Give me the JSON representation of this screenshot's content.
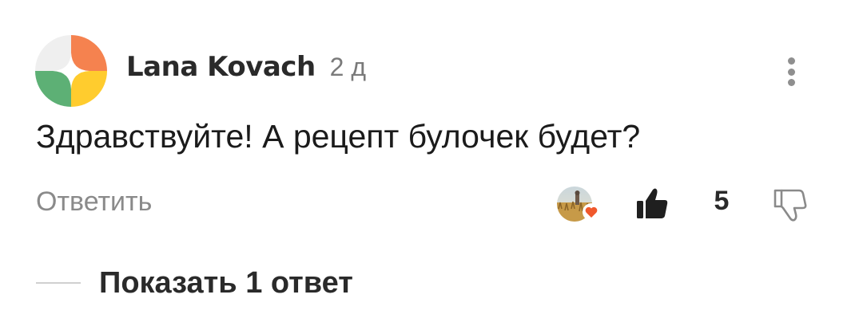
{
  "comment": {
    "author": "Lana Kovach",
    "time_ago": "2 д",
    "text": "Здравствуйте! А рецепт булочек будет?",
    "reply_label": "Ответить",
    "like_count": "5",
    "show_replies_label": "Показать 1 ответ",
    "icons": {
      "avatar": "multicolor-leaf-avatar",
      "more": "more-vertical-icon",
      "reactor": "reactor-avatar-with-heart",
      "like": "thumbs-up-filled-icon",
      "dislike": "thumbs-down-outline-icon"
    },
    "colors": {
      "avatar_orange": "#F5824F",
      "avatar_green": "#5DB075",
      "avatar_yellow": "#FFCC2E",
      "avatar_gray": "#EFEFEF",
      "heart": "#F0582C"
    }
  }
}
